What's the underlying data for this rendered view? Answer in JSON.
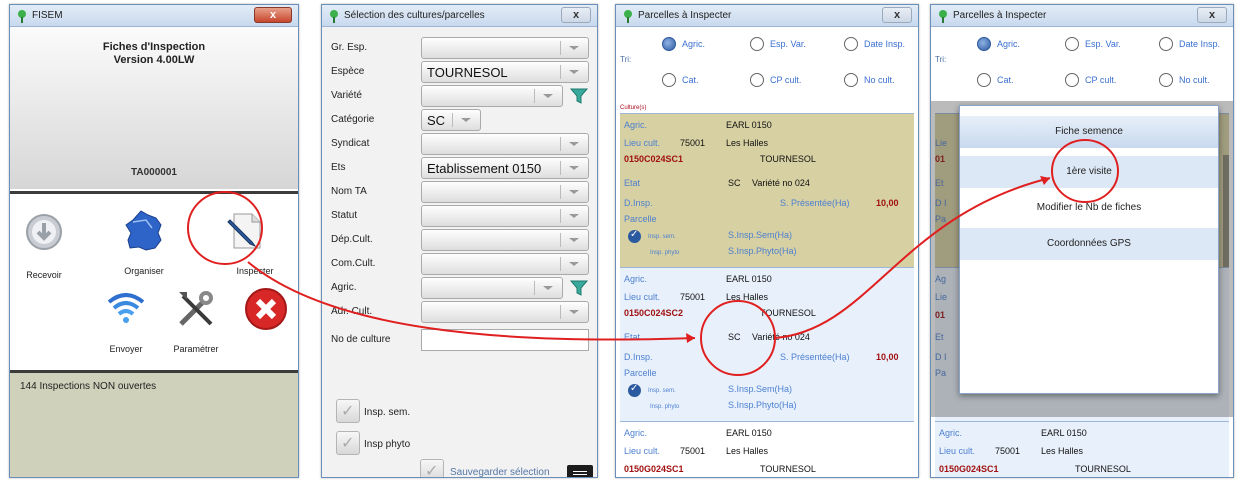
{
  "accent": "#4d7fd0",
  "annotation_color": "#e02020",
  "w1": {
    "title": "FISEM",
    "close": "x",
    "header_line1": "Fiches d'Inspection",
    "header_line2": "Version 4.00LW",
    "terminal_id": "TA000001",
    "buttons": {
      "recevoir": "Recevoir",
      "organiser": "Organiser",
      "inspecter": "Inspecter",
      "envoyer": "Envoyer",
      "parametrer": "Paramétrer"
    },
    "message": "144 Inspections NON ouvertes"
  },
  "w2": {
    "title": "Sélection des cultures/parcelles",
    "close": "x",
    "fields": [
      {
        "label": "Gr. Esp.",
        "value": ""
      },
      {
        "label": "Espèce",
        "value": "TOURNESOL"
      },
      {
        "label": "Variété",
        "value": ""
      },
      {
        "label": "Catégorie",
        "value": "SC"
      },
      {
        "label": "Syndicat",
        "value": ""
      },
      {
        "label": "Ets",
        "value": "Etablissement 0150"
      },
      {
        "label": "Nom TA",
        "value": ""
      },
      {
        "label": "Statut",
        "value": ""
      },
      {
        "label": "Dép.Cult.",
        "value": ""
      },
      {
        "label": "Com.Cult.",
        "value": ""
      },
      {
        "label": "Agric.",
        "value": ""
      },
      {
        "label": "Adr. Cult.",
        "value": ""
      },
      {
        "label": "No de culture",
        "value": ""
      }
    ],
    "insp_sem": "Insp. sem.",
    "insp_phyto": "Insp phyto",
    "save": "Sauvegarder sélection"
  },
  "w3": {
    "title": "Parcelles à Inspecter",
    "close": "x",
    "tri": "Tri:",
    "radios": [
      "Agric.",
      "Esp. Var.",
      "Date Insp.",
      "Cat.",
      "CP cult.",
      "No cult."
    ],
    "list_header": "Culture(s)",
    "cards": [
      {
        "agric_lbl": "Agric.",
        "agric": "EARL 0150",
        "lieu_lbl": "Lieu cult.",
        "cp": "75001",
        "lieu": "Les Halles",
        "code": "0150C024SC1",
        "espece": "TOURNESOL",
        "etat_lbl": "Etat",
        "cat": "SC",
        "variete": "Variété no 024",
        "dinsp_lbl": "D.Insp.",
        "spres_lbl": "S. Présentée(Ha)",
        "spres": "10,00",
        "parcelle_lbl": "Parcelle",
        "insp_sem": "Insp. sem.",
        "insp_phyto": "Insp. phyto",
        "sinsp_sem": "S.Insp.Sem(Ha)",
        "sinsp_phyto": "S.Insp.Phyto(Ha)"
      },
      {
        "agric_lbl": "Agric.",
        "agric": "EARL 0150",
        "lieu_lbl": "Lieu cult.",
        "cp": "75001",
        "lieu": "Les Halles",
        "code": "0150C024SC2",
        "espece": "TOURNESOL",
        "etat_lbl": "Etat",
        "cat": "SC",
        "variete": "Variété no 024",
        "dinsp_lbl": "D.Insp.",
        "spres_lbl": "S. Présentée(Ha)",
        "spres": "10,00",
        "parcelle_lbl": "Parcelle",
        "insp_sem": "Insp. sem.",
        "insp_phyto": "Insp. phyto",
        "sinsp_sem": "S.Insp.Sem(Ha)",
        "sinsp_phyto": "S.Insp.Phyto(Ha)"
      },
      {
        "agric_lbl": "Agric.",
        "agric": "EARL 0150",
        "lieu_lbl": "Lieu cult.",
        "cp": "75001",
        "lieu": "Les Halles",
        "code": "0150G024SC1",
        "espece": "TOURNESOL"
      }
    ]
  },
  "w4": {
    "title": "Parcelles à Inspecter",
    "close": "x",
    "tri": "Tri:",
    "radios": [
      "Agric.",
      "Esp. Var.",
      "Date Insp.",
      "Cat.",
      "CP cult.",
      "No cult."
    ],
    "popup_items": [
      "Fiche semence",
      "1ère visite",
      "Modifier le Nb de fiches",
      "Coordonnées GPS"
    ],
    "bottom_card": {
      "agric_lbl": "Agric.",
      "agric": "EARL 0150",
      "lieu_lbl": "Lieu cult.",
      "cp": "75001",
      "lieu": "Les Halles",
      "code": "0150G024SC1",
      "espece": "TOURNESOL"
    },
    "behind_fragments": [
      "Ag",
      "Lie",
      "01",
      "Et",
      "D I",
      "Pa"
    ]
  }
}
